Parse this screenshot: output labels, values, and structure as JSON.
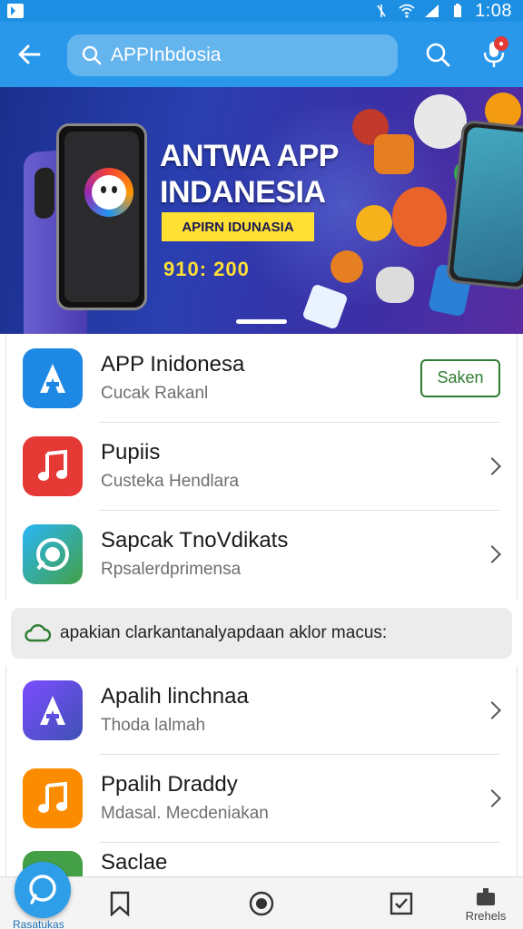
{
  "status_bar": {
    "time": "1:08"
  },
  "app_bar": {
    "search_value": "APPInbdosia"
  },
  "banner": {
    "title_line1": "ANTWA APP",
    "title_line2": "INDANESIA",
    "chip": "APIRN IDUNASIA",
    "number": "910: 200"
  },
  "list_top": [
    {
      "title": "APP Inidonesa",
      "subtitle": "Cucak Rakanl",
      "action": "Saken",
      "icon": "app-a-icon",
      "color": "#1e88e5"
    },
    {
      "title": "Pupiis",
      "subtitle": "Custeka Hendlara",
      "icon": "music-note-icon",
      "color": "#e53935"
    },
    {
      "title": "Sapcak TnoVdikats",
      "subtitle": "Rpsalerdprimensa",
      "icon": "chat-sync-icon",
      "color": "#43a047"
    }
  ],
  "notice": {
    "text": "apakian clarkantanalyapdaan aklor macus:"
  },
  "list_bottom": [
    {
      "title": "Apalih linchnaa",
      "subtitle": "Thoda lalmah",
      "icon": "app-a-icon",
      "color": "#5c4ee0"
    },
    {
      "title": "Ppalih Draddy",
      "subtitle": "Mdasal. Mecdeniakan",
      "icon": "music-note-icon",
      "color": "#fb8c00"
    },
    {
      "title": "Saclae",
      "subtitle": "",
      "icon": "chat-sync-icon",
      "color": "#43a047"
    }
  ],
  "bottom_nav": {
    "fab_label": "Rasatukas",
    "last_label": "Rrehels"
  },
  "colors": {
    "accent": "#2a98ea",
    "status": "#1d8fe3"
  }
}
